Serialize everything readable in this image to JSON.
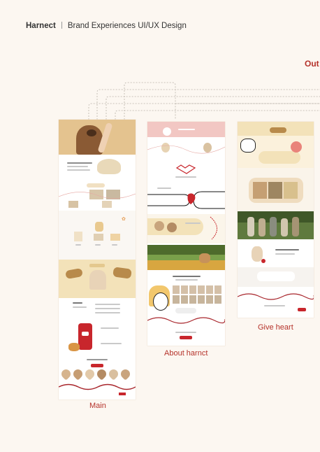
{
  "header": {
    "brand": "Harnect",
    "subtitle": "Brand Experiences UI/UX Design"
  },
  "next_label": "Out",
  "columns": [
    {
      "caption": "Main"
    },
    {
      "caption": "About harnct"
    },
    {
      "caption": "Give heart"
    }
  ],
  "colors": {
    "accent": "#b5322a",
    "background": "#fcf7f1",
    "cream": "#f3e2b9",
    "pink": "#f2c7c3"
  },
  "icons": [
    "heart-logo-icon",
    "phone-app-icon",
    "cat-icon",
    "dog-icon"
  ]
}
